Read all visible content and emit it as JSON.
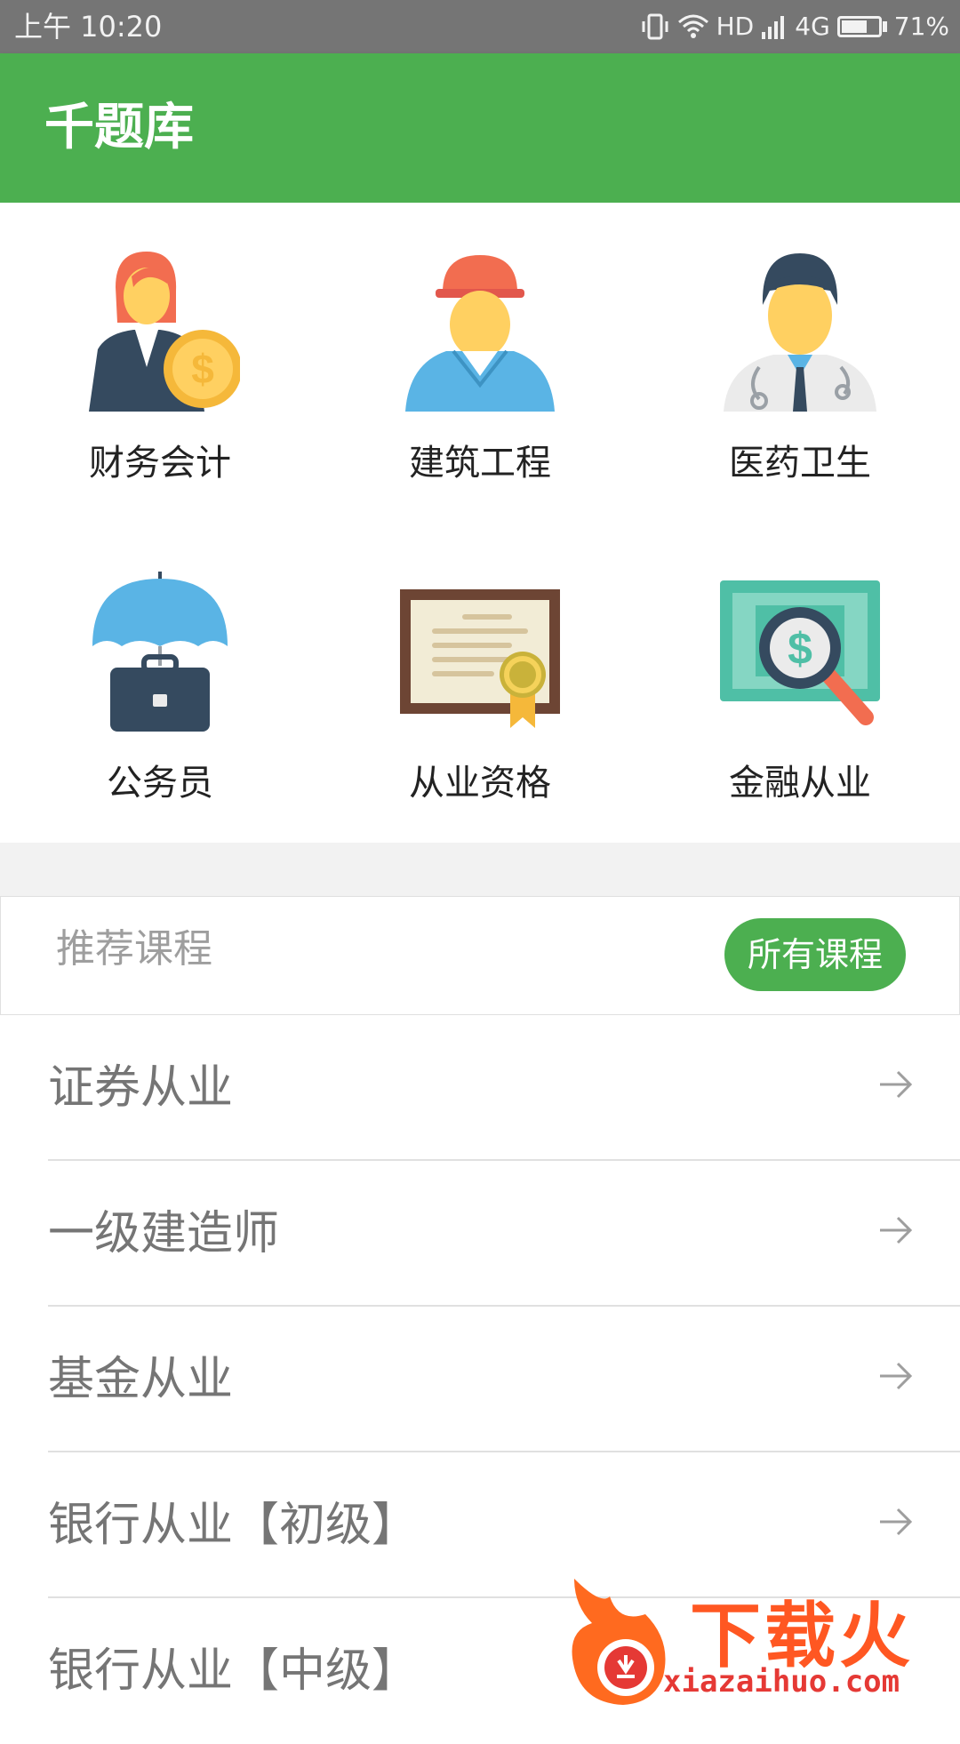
{
  "status_bar": {
    "time": "上午 10:20",
    "network_label": "HD",
    "signal_label": "4G",
    "battery_percent": "71%",
    "battery_level": 0.71
  },
  "app_bar": {
    "title": "千题库"
  },
  "categories": [
    {
      "label": "财务会计",
      "icon": "accountant-icon"
    },
    {
      "label": "建筑工程",
      "icon": "construction-worker-icon"
    },
    {
      "label": "医药卫生",
      "icon": "doctor-icon"
    },
    {
      "label": "公务员",
      "icon": "umbrella-briefcase-icon"
    },
    {
      "label": "从业资格",
      "icon": "certificate-icon"
    },
    {
      "label": "金融从业",
      "icon": "money-search-icon"
    }
  ],
  "recommended": {
    "title": "推荐课程",
    "all_button": "所有课程"
  },
  "courses": [
    {
      "label": "证券从业"
    },
    {
      "label": "一级建造师"
    },
    {
      "label": "基金从业"
    },
    {
      "label": "银行从业【初级】"
    },
    {
      "label": "银行从业【中级】"
    }
  ],
  "watermark": {
    "brand": "下载火",
    "url": "xiazaihuo.com"
  },
  "colors": {
    "primary": "#4caf50",
    "status_bar": "#757575"
  }
}
